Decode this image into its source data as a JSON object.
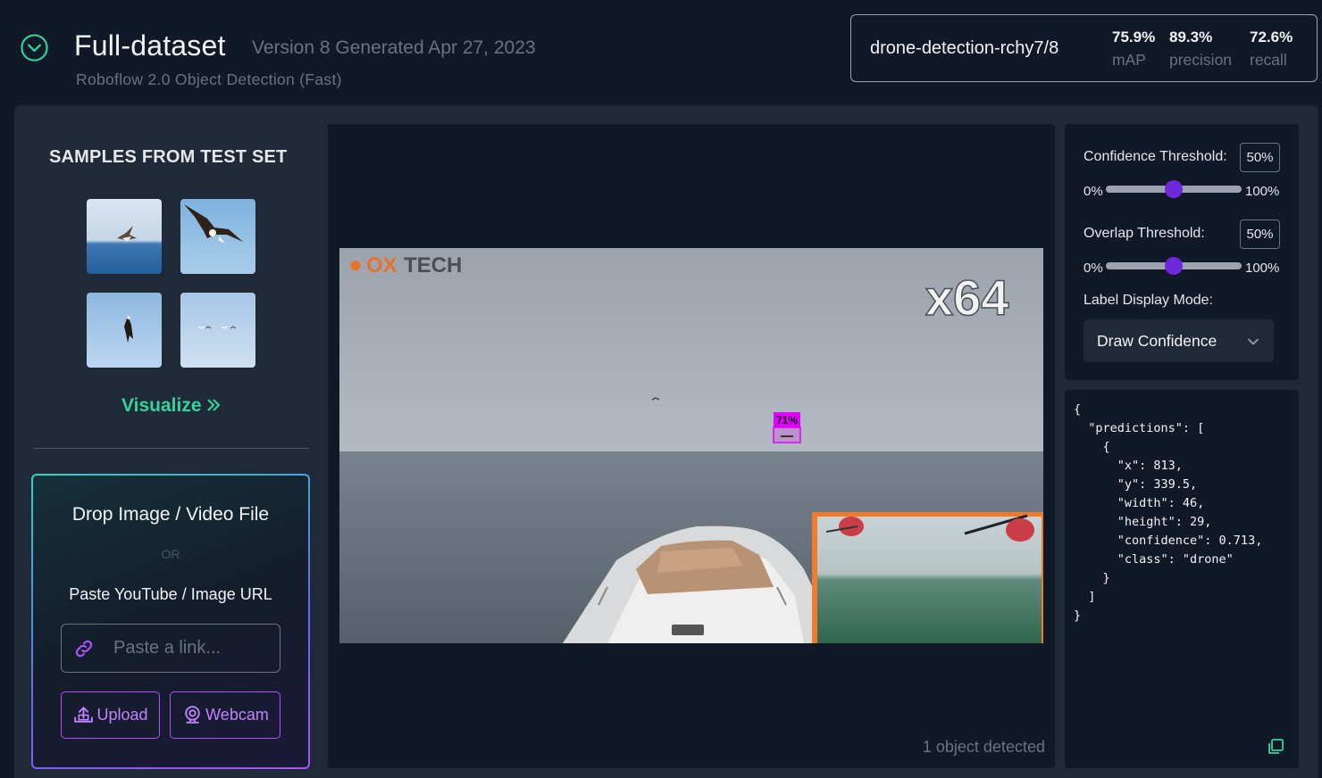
{
  "header": {
    "title": "Full-dataset",
    "version": "Version 8 Generated Apr 27, 2023",
    "model_type": "Roboflow 2.0 Object Detection (Fast)"
  },
  "model_card": {
    "model_id": "drone-detection-rchy7/8",
    "metrics": [
      {
        "value": "75.9%",
        "label": "mAP"
      },
      {
        "value": "89.3%",
        "label": "precision"
      },
      {
        "value": "72.6%",
        "label": "recall"
      }
    ]
  },
  "samples": {
    "title": "SAMPLES FROM TEST SET",
    "visualize_label": "Visualize",
    "visualize_icon": "double-chevron-right-icon"
  },
  "upload": {
    "drop_title": "Drop Image / Video File",
    "or_text": "OR",
    "paste_label": "Paste YouTube / Image URL",
    "link_placeholder": "Paste a link...",
    "upload_label": "Upload",
    "webcam_label": "Webcam"
  },
  "viewer": {
    "overlay_logo_text": "TECH",
    "overlay_zoom_text": "x64",
    "detection_label": "71%",
    "objects_detected": "1 object detected"
  },
  "settings": {
    "confidence_label": "Confidence Threshold:",
    "confidence_value": "50%",
    "confidence_fraction": 0.5,
    "overlap_label": "Overlap Threshold:",
    "overlap_value": "50%",
    "overlap_fraction": 0.5,
    "slider_min": "0%",
    "slider_max": "100%",
    "label_mode_label": "Label Display Mode:",
    "label_mode_value": "Draw Confidence"
  },
  "json_output": "{\n  \"predictions\": [\n    {\n      \"x\": 813,\n      \"y\": 339.5,\n      \"width\": 46,\n      \"height\": 29,\n      \"confidence\": 0.713,\n      \"class\": \"drone\"\n    }\n  ]\n}",
  "colors": {
    "accent_green": "#34d399",
    "accent_purple": "#a855f7",
    "slider_thumb": "#6d28d9",
    "detection_box": "#e100ff"
  }
}
